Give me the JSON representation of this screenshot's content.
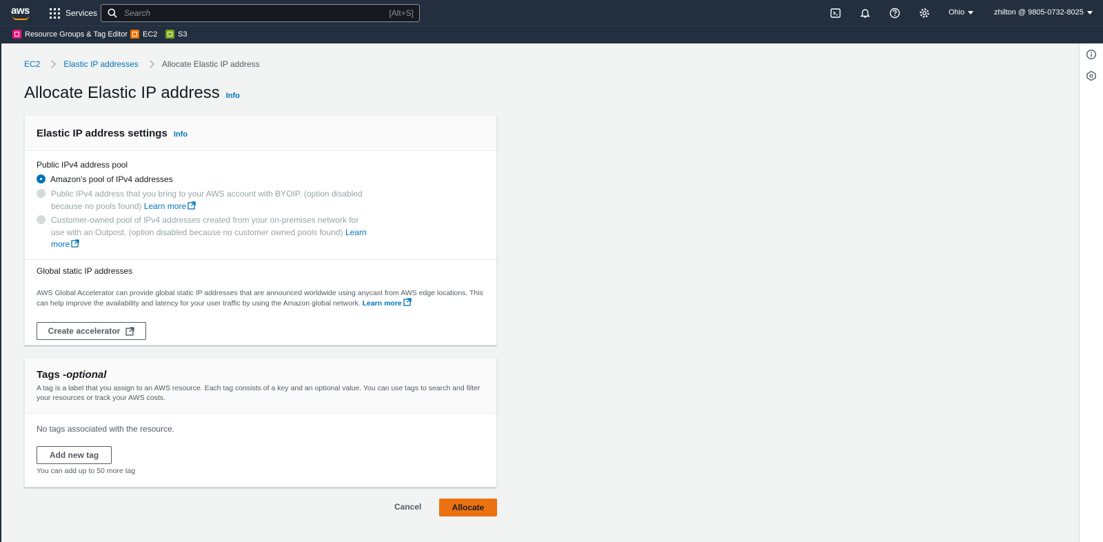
{
  "topnav": {
    "logo_text": "aws",
    "services_label": "Services",
    "search_placeholder": "Search",
    "search_shortcut": "[Alt+S]",
    "region": "Ohio",
    "account": "zhilton @ 9805-0732-8025"
  },
  "favorites": [
    {
      "label": "Resource Groups & Tag Editor",
      "color": "#e7157b"
    },
    {
      "label": "EC2",
      "color": "#ed7100"
    },
    {
      "label": "S3",
      "color": "#7aa116"
    }
  ],
  "breadcrumb": {
    "items": [
      "EC2",
      "Elastic IP addresses"
    ],
    "current": "Allocate Elastic IP address"
  },
  "page": {
    "title": "Allocate Elastic IP address",
    "info": "Info"
  },
  "settings": {
    "title": "Elastic IP address settings",
    "info": "Info",
    "pool_label": "Public IPv4 address pool",
    "option_amazon": "Amazon's pool of IPv4 addresses",
    "option_byoip": "Public IPv4 address that you bring to your AWS account with BYOIP. (option disabled because no pools found)",
    "option_customer": "Customer-owned pool of IPv4 addresses created from your on-premises network for use with an Outpost. (option disabled because no customer owned pools found)",
    "learn_more": "Learn more",
    "global_label": "Global static IP addresses",
    "global_desc": "AWS Global Accelerator can provide global static IP addresses that are announced worldwide using anycast from AWS edge locations. This can help improve the availability and latency for your user traffic by using the Amazon global network.",
    "create_accelerator": "Create accelerator"
  },
  "tags": {
    "title": "Tags - ",
    "title_italic": "optional",
    "desc": "A tag is a label that you assign to an AWS resource. Each tag consists of a key and an optional value. You can use tags to search and filter your resources or track your AWS costs.",
    "empty": "No tags associated with the resource.",
    "add_button": "Add new tag",
    "limit": "You can add up to 50 more tag"
  },
  "actions": {
    "cancel": "Cancel",
    "allocate": "Allocate"
  },
  "colors": {
    "nav_bg": "#232f3e",
    "link": "#0073bb",
    "primary": "#ec7211"
  }
}
